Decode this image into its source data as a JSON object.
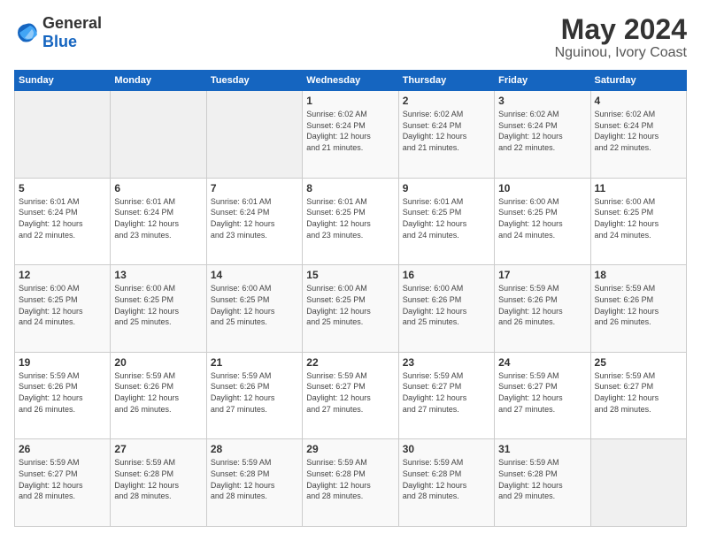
{
  "logo": {
    "general": "General",
    "blue": "Blue"
  },
  "header": {
    "month": "May 2024",
    "location": "Nguinou, Ivory Coast"
  },
  "weekdays": [
    "Sunday",
    "Monday",
    "Tuesday",
    "Wednesday",
    "Thursday",
    "Friday",
    "Saturday"
  ],
  "weeks": [
    [
      {
        "day": "",
        "info": ""
      },
      {
        "day": "",
        "info": ""
      },
      {
        "day": "",
        "info": ""
      },
      {
        "day": "1",
        "info": "Sunrise: 6:02 AM\nSunset: 6:24 PM\nDaylight: 12 hours\nand 21 minutes."
      },
      {
        "day": "2",
        "info": "Sunrise: 6:02 AM\nSunset: 6:24 PM\nDaylight: 12 hours\nand 21 minutes."
      },
      {
        "day": "3",
        "info": "Sunrise: 6:02 AM\nSunset: 6:24 PM\nDaylight: 12 hours\nand 22 minutes."
      },
      {
        "day": "4",
        "info": "Sunrise: 6:02 AM\nSunset: 6:24 PM\nDaylight: 12 hours\nand 22 minutes."
      }
    ],
    [
      {
        "day": "5",
        "info": "Sunrise: 6:01 AM\nSunset: 6:24 PM\nDaylight: 12 hours\nand 22 minutes."
      },
      {
        "day": "6",
        "info": "Sunrise: 6:01 AM\nSunset: 6:24 PM\nDaylight: 12 hours\nand 23 minutes."
      },
      {
        "day": "7",
        "info": "Sunrise: 6:01 AM\nSunset: 6:24 PM\nDaylight: 12 hours\nand 23 minutes."
      },
      {
        "day": "8",
        "info": "Sunrise: 6:01 AM\nSunset: 6:25 PM\nDaylight: 12 hours\nand 23 minutes."
      },
      {
        "day": "9",
        "info": "Sunrise: 6:01 AM\nSunset: 6:25 PM\nDaylight: 12 hours\nand 24 minutes."
      },
      {
        "day": "10",
        "info": "Sunrise: 6:00 AM\nSunset: 6:25 PM\nDaylight: 12 hours\nand 24 minutes."
      },
      {
        "day": "11",
        "info": "Sunrise: 6:00 AM\nSunset: 6:25 PM\nDaylight: 12 hours\nand 24 minutes."
      }
    ],
    [
      {
        "day": "12",
        "info": "Sunrise: 6:00 AM\nSunset: 6:25 PM\nDaylight: 12 hours\nand 24 minutes."
      },
      {
        "day": "13",
        "info": "Sunrise: 6:00 AM\nSunset: 6:25 PM\nDaylight: 12 hours\nand 25 minutes."
      },
      {
        "day": "14",
        "info": "Sunrise: 6:00 AM\nSunset: 6:25 PM\nDaylight: 12 hours\nand 25 minutes."
      },
      {
        "day": "15",
        "info": "Sunrise: 6:00 AM\nSunset: 6:25 PM\nDaylight: 12 hours\nand 25 minutes."
      },
      {
        "day": "16",
        "info": "Sunrise: 6:00 AM\nSunset: 6:26 PM\nDaylight: 12 hours\nand 25 minutes."
      },
      {
        "day": "17",
        "info": "Sunrise: 5:59 AM\nSunset: 6:26 PM\nDaylight: 12 hours\nand 26 minutes."
      },
      {
        "day": "18",
        "info": "Sunrise: 5:59 AM\nSunset: 6:26 PM\nDaylight: 12 hours\nand 26 minutes."
      }
    ],
    [
      {
        "day": "19",
        "info": "Sunrise: 5:59 AM\nSunset: 6:26 PM\nDaylight: 12 hours\nand 26 minutes."
      },
      {
        "day": "20",
        "info": "Sunrise: 5:59 AM\nSunset: 6:26 PM\nDaylight: 12 hours\nand 26 minutes."
      },
      {
        "day": "21",
        "info": "Sunrise: 5:59 AM\nSunset: 6:26 PM\nDaylight: 12 hours\nand 27 minutes."
      },
      {
        "day": "22",
        "info": "Sunrise: 5:59 AM\nSunset: 6:27 PM\nDaylight: 12 hours\nand 27 minutes."
      },
      {
        "day": "23",
        "info": "Sunrise: 5:59 AM\nSunset: 6:27 PM\nDaylight: 12 hours\nand 27 minutes."
      },
      {
        "day": "24",
        "info": "Sunrise: 5:59 AM\nSunset: 6:27 PM\nDaylight: 12 hours\nand 27 minutes."
      },
      {
        "day": "25",
        "info": "Sunrise: 5:59 AM\nSunset: 6:27 PM\nDaylight: 12 hours\nand 28 minutes."
      }
    ],
    [
      {
        "day": "26",
        "info": "Sunrise: 5:59 AM\nSunset: 6:27 PM\nDaylight: 12 hours\nand 28 minutes."
      },
      {
        "day": "27",
        "info": "Sunrise: 5:59 AM\nSunset: 6:28 PM\nDaylight: 12 hours\nand 28 minutes."
      },
      {
        "day": "28",
        "info": "Sunrise: 5:59 AM\nSunset: 6:28 PM\nDaylight: 12 hours\nand 28 minutes."
      },
      {
        "day": "29",
        "info": "Sunrise: 5:59 AM\nSunset: 6:28 PM\nDaylight: 12 hours\nand 28 minutes."
      },
      {
        "day": "30",
        "info": "Sunrise: 5:59 AM\nSunset: 6:28 PM\nDaylight: 12 hours\nand 28 minutes."
      },
      {
        "day": "31",
        "info": "Sunrise: 5:59 AM\nSunset: 6:28 PM\nDaylight: 12 hours\nand 29 minutes."
      },
      {
        "day": "",
        "info": ""
      }
    ]
  ]
}
